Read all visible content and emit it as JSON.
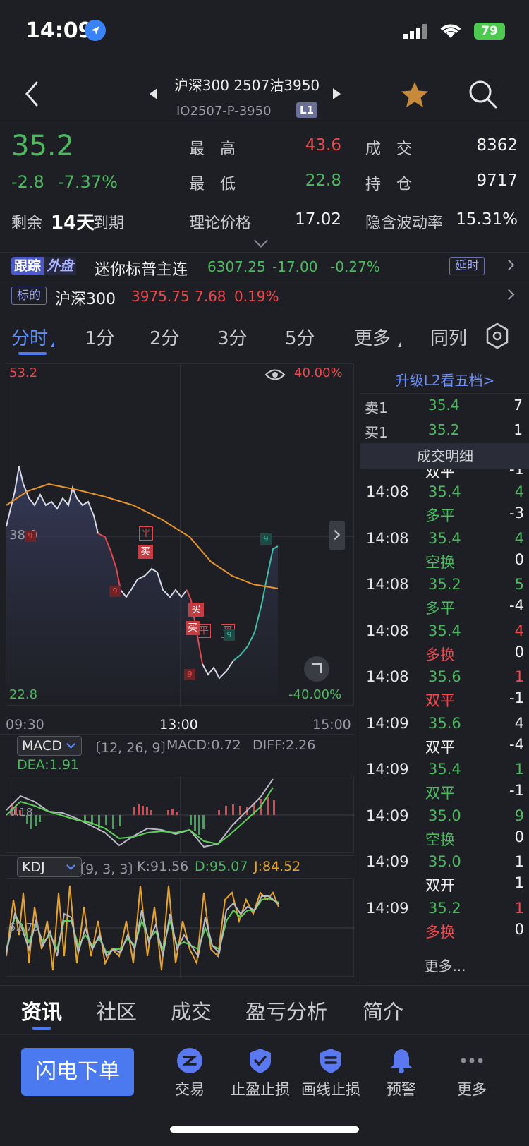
{
  "status_bar": {
    "time": "14:09",
    "battery": "79"
  },
  "header": {
    "contract_name": "沪深300 2507沽3950",
    "contract_code": "IO2507-P-3950",
    "level": "L1"
  },
  "quote": {
    "last_price": "35.2",
    "change": "-2.8",
    "change_pct": "-7.37%",
    "high_label": "最　高",
    "high": "43.6",
    "low_label": "最　低",
    "low": "22.8",
    "volume_label": "成　交",
    "volume": "8362",
    "oi_label": "持　仓",
    "open_interest": "9717",
    "expiry_prefix": "剩余",
    "expiry_days": "14天",
    "expiry_suffix": "到期",
    "theoretical_label": "理论价格",
    "theoretical_price": "17.02",
    "iv_label": "隐含波动率",
    "implied_vol": "15.31%"
  },
  "tracking": {
    "badge_a": "跟踪",
    "badge_b": "外盘",
    "name": "迷你标普主连",
    "price": "6307.25",
    "change": "-17.00",
    "change_pct": "-0.27%",
    "delay": "延时"
  },
  "underlying": {
    "badge": "标的",
    "name": "沪深300",
    "price": "3975.75",
    "change": "7.68",
    "change_pct": "0.19%"
  },
  "period_tabs": [
    "分时",
    "1分",
    "2分",
    "3分",
    "5分",
    "更多",
    "同列"
  ],
  "chart": {
    "y_top": "53.2",
    "y_bottom": "22.8",
    "y_mid": "38.0",
    "pct_top": "40.00%",
    "pct_bottom": "-40.00%",
    "x_labels": [
      "09:30",
      "13:00",
      "15:00"
    ],
    "markers": [
      "平",
      "买",
      "买",
      "买",
      "平",
      "平",
      "9",
      "9",
      "9",
      "9",
      "9"
    ]
  },
  "macd": {
    "name": "MACD",
    "params": "〔12, 26, 9〕",
    "macd": "MACD:0.72",
    "diff": "DIFF:2.26",
    "dea": "DEA:1.91",
    "axis": "0.18"
  },
  "kdj": {
    "name": "KDJ",
    "params": "〔9, 3, 3〕",
    "k": "K:91.56",
    "d": "D:95.07",
    "j": "J:84.52",
    "axis": "52.79"
  },
  "order_book": {
    "upgrade": "升级L2看五档>",
    "rows": [
      {
        "side": "卖1",
        "price": "35.4",
        "qty": "7"
      },
      {
        "side": "买1",
        "price": "35.2",
        "qty": "1"
      }
    ],
    "trades_title": "成交明细",
    "partial_row": {
      "type": "双平",
      "delta": "-1"
    },
    "trades": [
      {
        "time": "14:08",
        "price": "35.4",
        "vol": "4",
        "vol_color": "green",
        "type": "多平",
        "type_color": "green",
        "delta": "-3"
      },
      {
        "time": "14:08",
        "price": "35.4",
        "vol": "4",
        "vol_color": "green",
        "type": "空换",
        "type_color": "green",
        "delta": "0"
      },
      {
        "time": "14:08",
        "price": "35.2",
        "vol": "5",
        "vol_color": "green",
        "type": "多平",
        "type_color": "green",
        "delta": "-4"
      },
      {
        "time": "14:08",
        "price": "35.4",
        "vol": "4",
        "vol_color": "red",
        "type": "多换",
        "type_color": "red",
        "delta": "0"
      },
      {
        "time": "14:08",
        "price": "35.6",
        "vol": "1",
        "vol_color": "red",
        "type": "双平",
        "type_color": "red",
        "delta": "-1"
      },
      {
        "time": "14:09",
        "price": "35.6",
        "vol": "4",
        "vol_color": "white",
        "type": "双平",
        "type_color": "white",
        "delta": "-4"
      },
      {
        "time": "14:09",
        "price": "35.4",
        "vol": "1",
        "vol_color": "green",
        "type": "双平",
        "type_color": "green",
        "delta": "-1"
      },
      {
        "time": "14:09",
        "price": "35.0",
        "vol": "9",
        "vol_color": "green",
        "type": "空换",
        "type_color": "green",
        "delta": "0"
      },
      {
        "time": "14:09",
        "price": "35.0",
        "vol": "1",
        "vol_color": "white",
        "type": "双开",
        "type_color": "white",
        "delta": "1"
      },
      {
        "time": "14:09",
        "price": "35.2",
        "vol": "1",
        "vol_color": "red",
        "type": "多换",
        "type_color": "red",
        "delta": "0"
      }
    ],
    "more": "更多..."
  },
  "info_tabs": [
    "资讯",
    "社区",
    "成交",
    "盈亏分析",
    "简介"
  ],
  "actions": {
    "flash_order": "闪电下单",
    "items": [
      "交易",
      "止盈止损",
      "画线止损",
      "预警",
      "更多"
    ]
  }
}
